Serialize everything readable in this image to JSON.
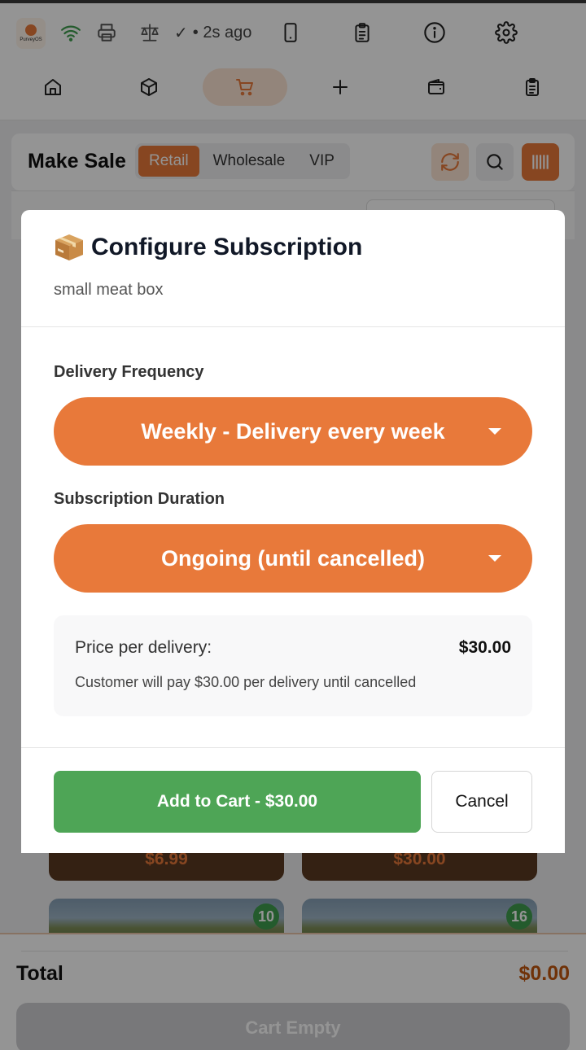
{
  "statusbar": {
    "logo_text": "PurveyOS",
    "sync_check": "✓",
    "sync_text": "• 2s ago",
    "icons": [
      "wifi-icon",
      "printer-icon",
      "scale-icon",
      "tablet-icon",
      "clipboard-icon",
      "info-icon",
      "gear-icon"
    ]
  },
  "nav": {
    "items": [
      "home",
      "package",
      "cart",
      "add",
      "wallet",
      "orders"
    ],
    "active": "cart"
  },
  "header": {
    "title": "Make Sale",
    "tabs": [
      "Retail",
      "Wholesale",
      "VIP"
    ],
    "active_tab": "Retail"
  },
  "products": [
    {
      "price": "$6.99"
    },
    {
      "price": "$30.00"
    },
    {
      "count": "10"
    },
    {
      "count": "16"
    }
  ],
  "footer": {
    "total_label": "Total",
    "total_value": "$0.00",
    "cart_button": "Cart Empty"
  },
  "modal": {
    "title": "Configure Subscription",
    "subtitle": "small meat box",
    "frequency_label": "Delivery Frequency",
    "frequency_value": "Weekly - Delivery every week",
    "duration_label": "Subscription Duration",
    "duration_value": "Ongoing (until cancelled)",
    "price_label": "Price per delivery:",
    "price_value": "$30.00",
    "note": "Customer will pay $30.00 per delivery until cancelled",
    "add_button": "Add to Cart - $30.00",
    "cancel_button": "Cancel"
  },
  "colors": {
    "accent": "#e8793a",
    "success": "#4ea556",
    "total": "#c2560f"
  }
}
